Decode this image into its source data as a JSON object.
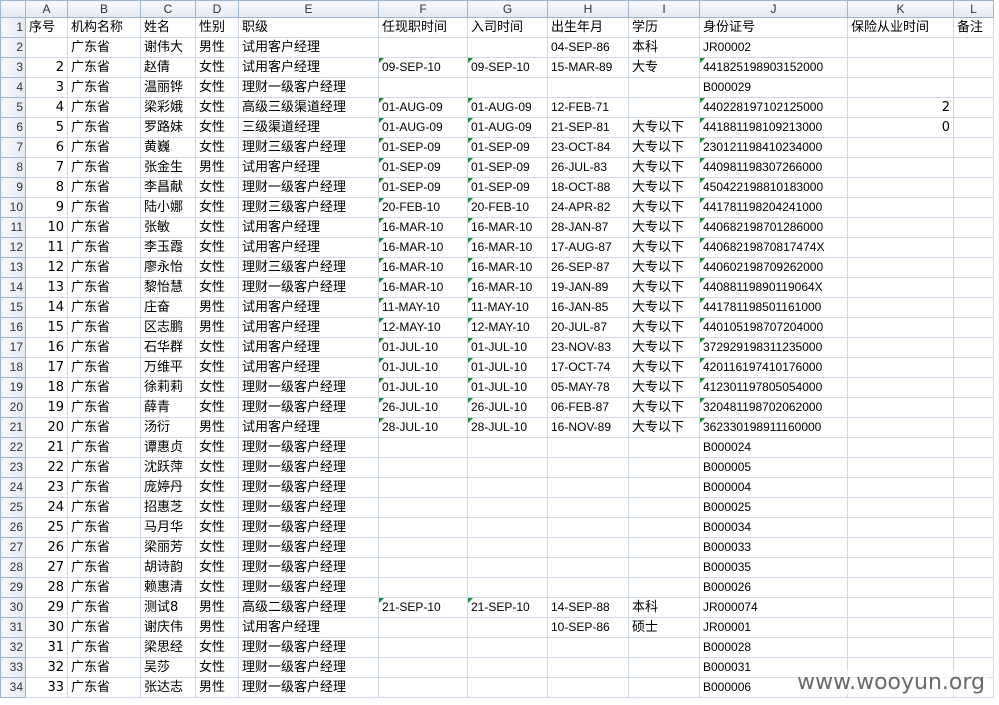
{
  "columns": [
    "A",
    "B",
    "C",
    "D",
    "E",
    "F",
    "G",
    "H",
    "I",
    "J",
    "K",
    "L"
  ],
  "headers": [
    "序号",
    "机构名称",
    "姓名",
    "性别",
    "职级",
    "任现职时间",
    "入司时间",
    "出生年月",
    "学历",
    "身份证号",
    "保险从业时间",
    "备注"
  ],
  "rows": [
    [
      "",
      "广东省",
      "谢伟大",
      "男性",
      "试用客户经理",
      "",
      "",
      "04-SEP-86",
      "本科",
      "JR00002",
      "",
      ""
    ],
    [
      "2",
      "广东省",
      "赵倩",
      "女性",
      "试用客户经理",
      "09-SEP-10",
      "09-SEP-10",
      "15-MAR-89",
      "大专",
      "441825198903152000",
      "",
      ""
    ],
    [
      "3",
      "广东省",
      "温丽铧",
      "女性",
      "理财一级客户经理",
      "",
      "",
      "",
      "",
      "B000029",
      "",
      ""
    ],
    [
      "4",
      "广东省",
      "梁彩娥",
      "女性",
      "高级三级渠道经理",
      "01-AUG-09",
      "01-AUG-09",
      "12-FEB-71",
      "",
      "440228197102125000",
      "2",
      ""
    ],
    [
      "5",
      "广东省",
      "罗路妹",
      "女性",
      "三级渠道经理",
      "01-AUG-09",
      "01-AUG-09",
      "21-SEP-81",
      "大专以下",
      "441881198109213000",
      "0",
      ""
    ],
    [
      "6",
      "广东省",
      "黄巍",
      "女性",
      "理财三级客户经理",
      "01-SEP-09",
      "01-SEP-09",
      "23-OCT-84",
      "大专以下",
      "230121198410234000",
      "",
      ""
    ],
    [
      "7",
      "广东省",
      "张金生",
      "男性",
      "试用客户经理",
      "01-SEP-09",
      "01-SEP-09",
      "26-JUL-83",
      "大专以下",
      "440981198307266000",
      "",
      ""
    ],
    [
      "8",
      "广东省",
      "李昌献",
      "女性",
      "理财一级客户经理",
      "01-SEP-09",
      "01-SEP-09",
      "18-OCT-88",
      "大专以下",
      "450422198810183000",
      "",
      ""
    ],
    [
      "9",
      "广东省",
      "陆小娜",
      "女性",
      "理财三级客户经理",
      "20-FEB-10",
      "20-FEB-10",
      "24-APR-82",
      "大专以下",
      "441781198204241000",
      "",
      ""
    ],
    [
      "10",
      "广东省",
      "张敏",
      "女性",
      "试用客户经理",
      "16-MAR-10",
      "16-MAR-10",
      "28-JAN-87",
      "大专以下",
      "440682198701286000",
      "",
      ""
    ],
    [
      "11",
      "广东省",
      "李玉霞",
      "女性",
      "试用客户经理",
      "16-MAR-10",
      "16-MAR-10",
      "17-AUG-87",
      "大专以下",
      "44068219870817474X",
      "",
      ""
    ],
    [
      "12",
      "广东省",
      "廖永怡",
      "女性",
      "理财三级客户经理",
      "16-MAR-10",
      "16-MAR-10",
      "26-SEP-87",
      "大专以下",
      "440602198709262000",
      "",
      ""
    ],
    [
      "13",
      "广东省",
      "黎怡慧",
      "女性",
      "理财一级客户经理",
      "16-MAR-10",
      "16-MAR-10",
      "19-JAN-89",
      "大专以下",
      "44088119890119064X",
      "",
      ""
    ],
    [
      "14",
      "广东省",
      "庄奋",
      "男性",
      "试用客户经理",
      "11-MAY-10",
      "11-MAY-10",
      "16-JAN-85",
      "大专以下",
      "441781198501161000",
      "",
      ""
    ],
    [
      "15",
      "广东省",
      "区志鹏",
      "男性",
      "试用客户经理",
      "12-MAY-10",
      "12-MAY-10",
      "20-JUL-87",
      "大专以下",
      "440105198707204000",
      "",
      ""
    ],
    [
      "16",
      "广东省",
      "石华群",
      "女性",
      "试用客户经理",
      "01-JUL-10",
      "01-JUL-10",
      "23-NOV-83",
      "大专以下",
      "372929198311235000",
      "",
      ""
    ],
    [
      "17",
      "广东省",
      "万维平",
      "女性",
      "试用客户经理",
      "01-JUL-10",
      "01-JUL-10",
      "17-OCT-74",
      "大专以下",
      "420116197410176000",
      "",
      ""
    ],
    [
      "18",
      "广东省",
      "徐莉莉",
      "女性",
      "理财一级客户经理",
      "01-JUL-10",
      "01-JUL-10",
      "05-MAY-78",
      "大专以下",
      "412301197805054000",
      "",
      ""
    ],
    [
      "19",
      "广东省",
      "薛青",
      "女性",
      "理财一级客户经理",
      "26-JUL-10",
      "26-JUL-10",
      "06-FEB-87",
      "大专以下",
      "320481198702062000",
      "",
      ""
    ],
    [
      "20",
      "广东省",
      "汤衍",
      "男性",
      "试用客户经理",
      "28-JUL-10",
      "28-JUL-10",
      "16-NOV-89",
      "大专以下",
      "362330198911160000",
      "",
      ""
    ],
    [
      "21",
      "广东省",
      "谭惠贞",
      "女性",
      "理财一级客户经理",
      "",
      "",
      "",
      "",
      "B000024",
      "",
      ""
    ],
    [
      "22",
      "广东省",
      "沈跃萍",
      "女性",
      "理财一级客户经理",
      "",
      "",
      "",
      "",
      "B000005",
      "",
      ""
    ],
    [
      "23",
      "广东省",
      "庞婷丹",
      "女性",
      "理财一级客户经理",
      "",
      "",
      "",
      "",
      "B000004",
      "",
      ""
    ],
    [
      "24",
      "广东省",
      "招惠芝",
      "女性",
      "理财一级客户经理",
      "",
      "",
      "",
      "",
      "B000025",
      "",
      ""
    ],
    [
      "25",
      "广东省",
      "马月华",
      "女性",
      "理财一级客户经理",
      "",
      "",
      "",
      "",
      "B000034",
      "",
      ""
    ],
    [
      "26",
      "广东省",
      "梁丽芳",
      "女性",
      "理财一级客户经理",
      "",
      "",
      "",
      "",
      "B000033",
      "",
      ""
    ],
    [
      "27",
      "广东省",
      "胡诗韵",
      "女性",
      "理财一级客户经理",
      "",
      "",
      "",
      "",
      "B000035",
      "",
      ""
    ],
    [
      "28",
      "广东省",
      "赖惠清",
      "女性",
      "理财一级客户经理",
      "",
      "",
      "",
      "",
      "B000026",
      "",
      ""
    ],
    [
      "29",
      "广东省",
      "测试8",
      "男性",
      "高级二级客户经理",
      "21-SEP-10",
      "21-SEP-10",
      "14-SEP-88",
      "本科",
      "JR000074",
      "",
      ""
    ],
    [
      "30",
      "广东省",
      "谢庆伟",
      "男性",
      "试用客户经理",
      "",
      "",
      "10-SEP-86",
      "硕士",
      "JR00001",
      "",
      ""
    ],
    [
      "31",
      "广东省",
      "梁思经",
      "女性",
      "理财一级客户经理",
      "",
      "",
      "",
      "",
      "B000028",
      "",
      ""
    ],
    [
      "32",
      "广东省",
      "吴莎",
      "女性",
      "理财一级客户经理",
      "",
      "",
      "",
      "",
      "B000031",
      "",
      ""
    ],
    [
      "33",
      "广东省",
      "张达志",
      "男性",
      "理财一级客户经理",
      "",
      "",
      "",
      "",
      "B000006",
      "",
      ""
    ]
  ],
  "first_row_index": "1",
  "data_row_start": 2,
  "watermark": "www.wooyun.org"
}
